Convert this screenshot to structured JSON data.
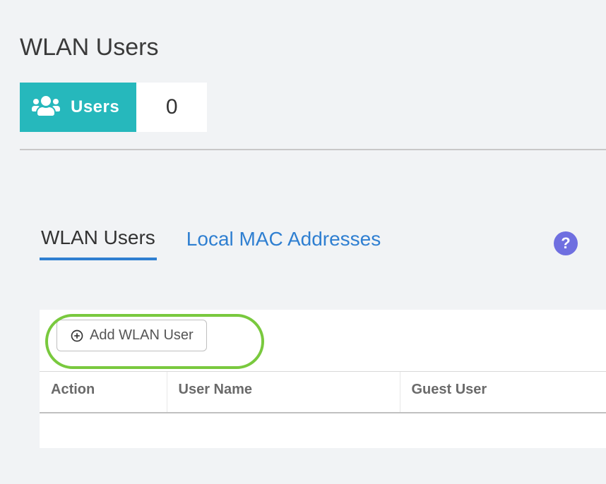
{
  "page": {
    "title": "WLAN Users"
  },
  "stat": {
    "label": "Users",
    "count": "0"
  },
  "tabs": {
    "wlanUsers": "WLAN Users",
    "localMac": "Local MAC Addresses"
  },
  "buttons": {
    "addWlanUser": "Add WLAN User"
  },
  "columns": {
    "action": "Action",
    "userName": "User Name",
    "guestUser": "Guest User"
  },
  "help": {
    "symbol": "?"
  },
  "icons": {
    "users": "users-icon",
    "plus": "plus-circle-icon",
    "help": "help-icon"
  }
}
